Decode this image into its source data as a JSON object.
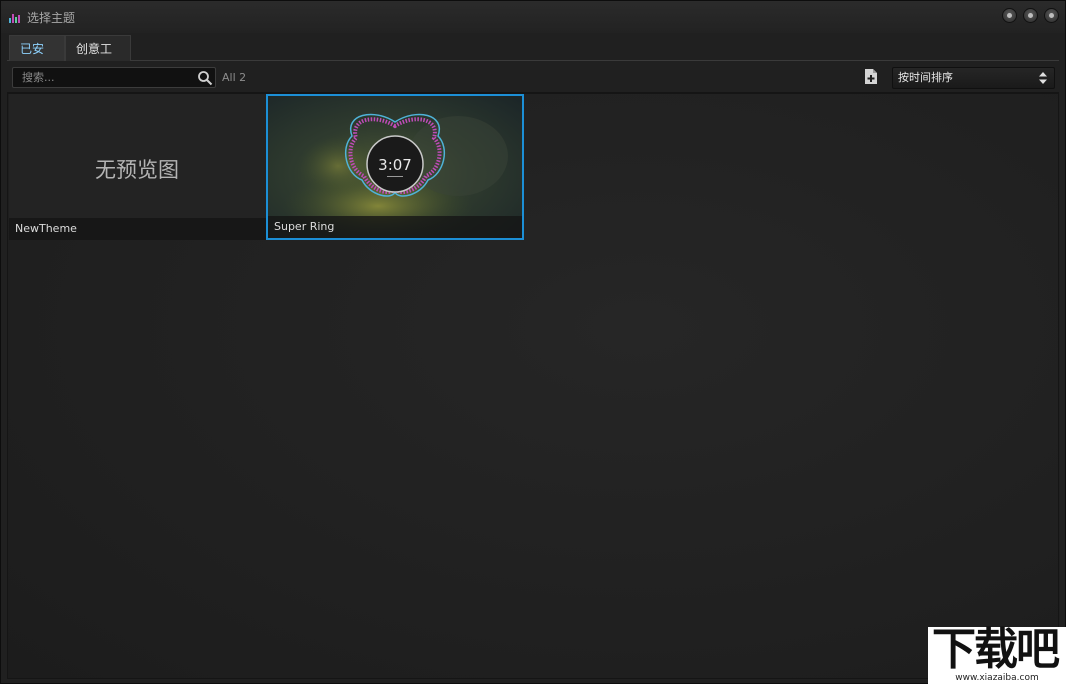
{
  "window": {
    "title": "选择主题"
  },
  "tabs": [
    {
      "label": "已安装",
      "active": true
    },
    {
      "label": "创意工坊",
      "active": false
    }
  ],
  "toolbar": {
    "search_placeholder": "搜索...",
    "search_value": "",
    "count_text": "All 2",
    "sort_value": "按时间排序",
    "add_icon": "add-file-icon"
  },
  "themes": [
    {
      "name": "NewTheme",
      "preview_text": "无预览图",
      "selected": false
    },
    {
      "name": "Super Ring",
      "clock": "3:07",
      "selected": true
    }
  ],
  "watermark": {
    "main": "下载吧",
    "url": "www.xiazaiba.com"
  },
  "colors": {
    "accent": "#1c8fd6",
    "active_tab_text": "#8fd3ff",
    "ring_magenta": "#c04cb8",
    "ring_cyan": "#4fb3d8"
  }
}
